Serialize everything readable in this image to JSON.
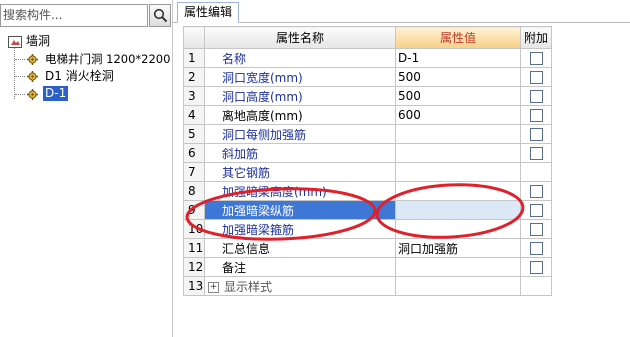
{
  "search": {
    "placeholder": "搜索构件..."
  },
  "tree": {
    "root": "墙洞",
    "children": [
      "电梯井门洞 1200*2200",
      "D1 消火栓洞",
      "D-1"
    ]
  },
  "tab": {
    "label": "属性编辑"
  },
  "grid": {
    "headers": {
      "name": "属性名称",
      "value": "属性值",
      "extra": "附加"
    },
    "rows": [
      {
        "num": "1",
        "name": "名称",
        "value": "D-1"
      },
      {
        "num": "2",
        "name": "洞口宽度(mm)",
        "value": "500"
      },
      {
        "num": "3",
        "name": "洞口高度(mm)",
        "value": "500"
      },
      {
        "num": "4",
        "name": "离地高度(mm)",
        "value": "600"
      },
      {
        "num": "5",
        "name": "洞口每侧加强筋",
        "value": ""
      },
      {
        "num": "6",
        "name": "斜加筋",
        "value": ""
      },
      {
        "num": "7",
        "name": "其它钢筋",
        "value": ""
      },
      {
        "num": "8",
        "name": "加强暗梁高度(mm)",
        "value": ""
      },
      {
        "num": "9",
        "name": "加强暗梁纵筋",
        "value": ""
      },
      {
        "num": "10",
        "name": "加强暗梁箍筋",
        "value": ""
      },
      {
        "num": "11",
        "name": "汇总信息",
        "value": "洞口加强筋"
      },
      {
        "num": "12",
        "name": "备注",
        "value": ""
      },
      {
        "num": "13",
        "name": "显示样式",
        "value": ""
      }
    ]
  },
  "icons": {
    "search": "search-icon",
    "folder": "folder-icon",
    "component": "gear-icon",
    "expand": "plus-expander-icon"
  },
  "colors": {
    "selection": "#3f77d6",
    "annotation": "#e0202a",
    "header_highlight": "#f8cf86",
    "link_text": "#1c2f9c"
  }
}
